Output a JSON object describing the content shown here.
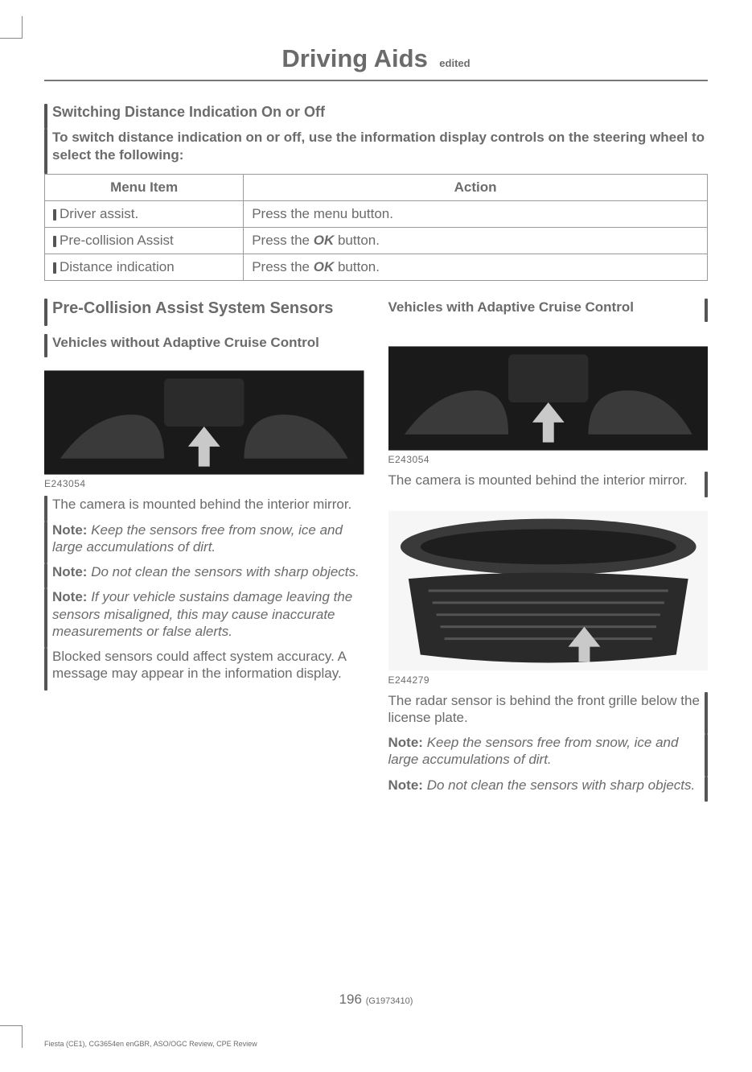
{
  "header": {
    "title": "Driving Aids",
    "tag": "edited"
  },
  "section1": {
    "h3": "Switching Distance Indication On or Off",
    "intro": "To switch distance indication on or off, use the information display controls on the steering wheel to select the following:"
  },
  "table": {
    "col1": "Menu Item",
    "col2": "Action",
    "rows": [
      {
        "menu": "Driver assist.",
        "action_pre": "Press the menu button."
      },
      {
        "menu": "Pre-collision Assist",
        "action_pre": "Press the ",
        "action_bold": "OK",
        "action_post": " button."
      },
      {
        "menu": "Distance indication",
        "action_pre": "Press the ",
        "action_bold": "OK",
        "action_post": " button."
      }
    ]
  },
  "left": {
    "h3": "Pre-Collision Assist System Sensors",
    "h5a": "Vehicles without Adaptive Cruise Control",
    "cap1": "E243054",
    "p1": "The camera is mounted behind the interior mirror.",
    "note1_label": "Note:",
    "note1": "Keep the sensors free from snow, ice and large accumulations of dirt.",
    "note2_label": "Note:",
    "note2": "Do not clean the sensors with sharp objects.",
    "note3_label": "Note:",
    "note3": "If your vehicle sustains damage leaving the sensors misaligned, this may cause inaccurate measurements or false alerts.",
    "p2": "Blocked sensors could affect system accuracy.   A message may appear in the information display."
  },
  "right": {
    "h5": "Vehicles with Adaptive Cruise Control",
    "cap1": "E243054",
    "p1": "The camera is mounted behind the interior mirror.",
    "cap2": "E244279",
    "p2": "The radar sensor is behind the front grille below the license plate.",
    "note1_label": "Note:",
    "note1": "Keep the sensors free from snow, ice and large accumulations of dirt.",
    "note2_label": "Note:",
    "note2": "Do not clean the sensors with sharp objects."
  },
  "footer": {
    "page": "196",
    "page_sub": "(G1973410)",
    "line": "Fiesta (CE1), CG3654en enGBR, ASO/OGC Review, CPE Review"
  }
}
